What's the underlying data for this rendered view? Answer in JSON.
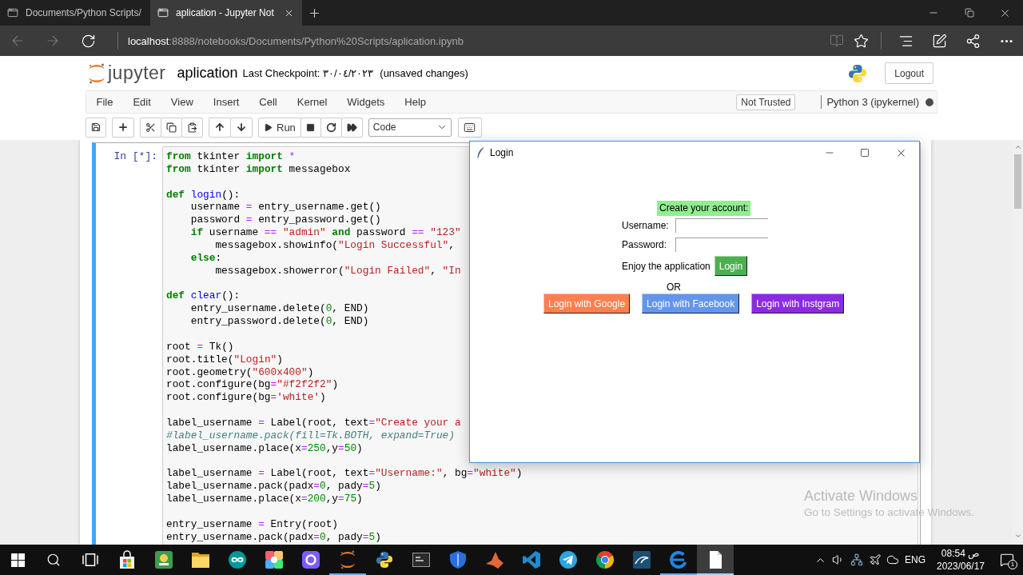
{
  "browser": {
    "tabs": [
      {
        "title": "Documents/Python Scripts/",
        "selected": false
      },
      {
        "title": "aplication - Jupyter Not",
        "selected": true
      }
    ],
    "navigation": {
      "back_disabled": true,
      "forward_disabled": true
    },
    "address": {
      "host": "localhost",
      "rest": ":8888/notebooks/Documents/Python%20Scripts/aplication.ipynb"
    }
  },
  "header": {
    "logo_text": "jupyter",
    "notebook_name": "aplication",
    "checkpoint": "Last Checkpoint: ٣٠/٠٤/٢٠٢٣",
    "save_status": "(unsaved changes)",
    "logout": "Logout"
  },
  "menu_bar": {
    "items": [
      "File",
      "Edit",
      "View",
      "Insert",
      "Cell",
      "Kernel",
      "Widgets",
      "Help"
    ],
    "trust": "Not Trusted",
    "kernel": "Python 3 (ipykernel)",
    "kernel_busy": true
  },
  "toolbar": {
    "run_label": "Run",
    "cell_type": "Code"
  },
  "cell": {
    "prompt": "In [*]:",
    "selected": true,
    "code_blocks": [
      {
        "lines": [
          {
            "tokens": [
              {
                "kind": "keyword",
                "text": "from"
              },
              {
                "kind": "plain",
                "text": " tkinter "
              },
              {
                "kind": "keyword",
                "text": "import"
              },
              {
                "kind": "operator",
                "text": " *"
              }
            ]
          },
          {
            "tokens": [
              {
                "kind": "keyword",
                "text": "from"
              },
              {
                "kind": "plain",
                "text": " tkinter "
              },
              {
                "kind": "keyword",
                "text": "import"
              },
              {
                "kind": "plain",
                "text": " messagebox"
              }
            ]
          }
        ]
      },
      {
        "lines": [
          {
            "tokens": [
              {
                "kind": "keyword",
                "text": "def"
              },
              {
                "kind": "name",
                "text": " login"
              },
              {
                "kind": "plain",
                "text": "():"
              }
            ],
            "children": [
              {
                "tokens": [
                  {
                    "kind": "plain",
                    "text": "username "
                  },
                  {
                    "kind": "operator",
                    "text": "="
                  },
                  {
                    "kind": "plain",
                    "text": " entry_username.get()"
                  }
                ]
              },
              {
                "tokens": [
                  {
                    "kind": "plain",
                    "text": "password "
                  },
                  {
                    "kind": "operator",
                    "text": "="
                  },
                  {
                    "kind": "plain",
                    "text": " entry_password.get()"
                  }
                ]
              },
              {
                "tokens": [
                  {
                    "kind": "keyword",
                    "text": "if"
                  },
                  {
                    "kind": "plain",
                    "text": " username "
                  },
                  {
                    "kind": "operator",
                    "text": "=="
                  },
                  {
                    "kind": "string",
                    "text": " \"admin\""
                  },
                  {
                    "kind": "keyword",
                    "text": " and"
                  },
                  {
                    "kind": "plain",
                    "text": " password "
                  },
                  {
                    "kind": "operator",
                    "text": "=="
                  },
                  {
                    "kind": "string",
                    "text": " \"123\""
                  }
                ],
                "children": [
                  {
                    "tokens": [
                      {
                        "kind": "plain",
                        "text": "messagebox.showinfo("
                      },
                      {
                        "kind": "string",
                        "text": "\"Login Successful\""
                      },
                      {
                        "kind": "plain",
                        "text": ","
                      }
                    ]
                  }
                ]
              },
              {
                "tokens": [
                  {
                    "kind": "keyword",
                    "text": "else"
                  },
                  {
                    "kind": "plain",
                    "text": ":"
                  }
                ],
                "children": [
                  {
                    "tokens": [
                      {
                        "kind": "plain",
                        "text": "messagebox.showerror("
                      },
                      {
                        "kind": "string",
                        "text": "\"Login Failed\""
                      },
                      {
                        "kind": "plain",
                        "text": ", "
                      },
                      {
                        "kind": "string",
                        "text": "\"In"
                      }
                    ]
                  }
                ]
              }
            ]
          }
        ]
      },
      {
        "lines": [
          {
            "tokens": [
              {
                "kind": "keyword",
                "text": "def"
              },
              {
                "kind": "name",
                "text": " clear"
              },
              {
                "kind": "plain",
                "text": "():"
              }
            ],
            "children": [
              {
                "tokens": [
                  {
                    "kind": "plain",
                    "text": "entry_username.delete("
                  },
                  {
                    "kind": "number",
                    "text": "0"
                  },
                  {
                    "kind": "plain",
                    "text": ", END)"
                  }
                ]
              },
              {
                "tokens": [
                  {
                    "kind": "plain",
                    "text": "entry_password.delete("
                  },
                  {
                    "kind": "number",
                    "text": "0"
                  },
                  {
                    "kind": "plain",
                    "text": ", END)"
                  }
                ]
              }
            ]
          }
        ]
      },
      {
        "lines": [
          {
            "tokens": [
              {
                "kind": "plain",
                "text": "root "
              },
              {
                "kind": "operator",
                "text": "="
              },
              {
                "kind": "plain",
                "text": " Tk()"
              }
            ]
          },
          {
            "tokens": [
              {
                "kind": "plain",
                "text": "root.title("
              },
              {
                "kind": "string",
                "text": "\"Login\""
              },
              {
                "kind": "plain",
                "text": ")"
              }
            ]
          },
          {
            "tokens": [
              {
                "kind": "plain",
                "text": "root.geometry("
              },
              {
                "kind": "string",
                "text": "\"600x400\""
              },
              {
                "kind": "plain",
                "text": ")"
              }
            ]
          },
          {
            "tokens": [
              {
                "kind": "plain",
                "text": "root.configure(bg"
              },
              {
                "kind": "operator",
                "text": "="
              },
              {
                "kind": "string",
                "text": "\"#f2f2f2\""
              },
              {
                "kind": "plain",
                "text": ")"
              }
            ]
          },
          {
            "tokens": [
              {
                "kind": "plain",
                "text": "root.configure(bg"
              },
              {
                "kind": "operator",
                "text": "="
              },
              {
                "kind": "string",
                "text": "'white'"
              },
              {
                "kind": "plain",
                "text": ")"
              }
            ]
          }
        ]
      },
      {
        "lines": [
          {
            "tokens": [
              {
                "kind": "plain",
                "text": "label_username "
              },
              {
                "kind": "operator",
                "text": "="
              },
              {
                "kind": "plain",
                "text": " Label(root, text"
              },
              {
                "kind": "operator",
                "text": "="
              },
              {
                "kind": "string",
                "text": "\"Create your a"
              }
            ]
          },
          {
            "tokens": [
              {
                "kind": "comment",
                "text": "#label_username.pack(fill=Tk.BOTH, expand=True)"
              }
            ]
          },
          {
            "tokens": [
              {
                "kind": "plain",
                "text": "label_username.place(x"
              },
              {
                "kind": "operator",
                "text": "="
              },
              {
                "kind": "number",
                "text": "250"
              },
              {
                "kind": "plain",
                "text": ",y"
              },
              {
                "kind": "operator",
                "text": "="
              },
              {
                "kind": "number",
                "text": "50"
              },
              {
                "kind": "plain",
                "text": ")"
              }
            ]
          }
        ]
      },
      {
        "lines": [
          {
            "tokens": [
              {
                "kind": "plain",
                "text": "label_username "
              },
              {
                "kind": "operator",
                "text": "="
              },
              {
                "kind": "plain",
                "text": " Label(root, text"
              },
              {
                "kind": "operator",
                "text": "="
              },
              {
                "kind": "string",
                "text": "\"Username:\""
              },
              {
                "kind": "plain",
                "text": ", bg"
              },
              {
                "kind": "operator",
                "text": "="
              },
              {
                "kind": "string",
                "text": "\"white\""
              },
              {
                "kind": "plain",
                "text": ")"
              }
            ]
          },
          {
            "tokens": [
              {
                "kind": "plain",
                "text": "label_username.pack(padx"
              },
              {
                "kind": "operator",
                "text": "="
              },
              {
                "kind": "number",
                "text": "0"
              },
              {
                "kind": "plain",
                "text": ", pady"
              },
              {
                "kind": "operator",
                "text": "="
              },
              {
                "kind": "number",
                "text": "5"
              },
              {
                "kind": "plain",
                "text": ")"
              }
            ]
          },
          {
            "tokens": [
              {
                "kind": "plain",
                "text": "label_username.place(x"
              },
              {
                "kind": "operator",
                "text": "="
              },
              {
                "kind": "number",
                "text": "200"
              },
              {
                "kind": "plain",
                "text": ",y"
              },
              {
                "kind": "operator",
                "text": "="
              },
              {
                "kind": "number",
                "text": "75"
              },
              {
                "kind": "plain",
                "text": ")"
              }
            ]
          }
        ]
      },
      {
        "lines": [
          {
            "tokens": [
              {
                "kind": "plain",
                "text": "entry_username "
              },
              {
                "kind": "operator",
                "text": "="
              },
              {
                "kind": "plain",
                "text": " Entry(root)"
              }
            ]
          },
          {
            "tokens": [
              {
                "kind": "plain",
                "text": "entry_username.pack(padx"
              },
              {
                "kind": "operator",
                "text": "="
              },
              {
                "kind": "number",
                "text": "0"
              },
              {
                "kind": "plain",
                "text": ", pady"
              },
              {
                "kind": "operator",
                "text": "="
              },
              {
                "kind": "number",
                "text": "5"
              },
              {
                "kind": "plain",
                "text": ")"
              }
            ]
          }
        ]
      }
    ]
  },
  "login_window": {
    "title": "Login",
    "heading": "Create your account:",
    "fields": [
      {
        "label": "Username:"
      },
      {
        "label": "Password:"
      }
    ],
    "note": "Enjoy the application",
    "login_button": "Login",
    "separator": "OR",
    "social_buttons": [
      {
        "label": "Login with Google",
        "color": "#ff7f50"
      },
      {
        "label": "Login with Facebook",
        "color": "#6495ed"
      },
      {
        "label": "Login with Instgram",
        "color": "#8a2be2"
      }
    ]
  },
  "activation_notice": {
    "title": "Activate Windows",
    "hint": "Go to Settings to activate Windows."
  },
  "taskbar": {
    "apps": [
      {
        "kind": "store",
        "running": false,
        "focused": false
      },
      {
        "kind": "tile",
        "running": false,
        "focused": false
      },
      {
        "kind": "folder",
        "running": false,
        "focused": false
      },
      {
        "kind": "infinity",
        "running": false,
        "focused": false
      },
      {
        "kind": "palette",
        "running": false,
        "focused": false
      },
      {
        "kind": "pad",
        "running": false,
        "focused": false
      },
      {
        "kind": "arcs",
        "running": true,
        "focused": false
      },
      {
        "kind": "snake",
        "running": false,
        "focused": false
      },
      {
        "kind": "terminal",
        "running": false,
        "focused": false
      },
      {
        "kind": "shield",
        "running": false,
        "focused": false
      },
      {
        "kind": "peak",
        "running": false,
        "focused": false
      },
      {
        "kind": "ribbon",
        "running": false,
        "focused": false
      },
      {
        "kind": "plane",
        "running": false,
        "focused": false
      },
      {
        "kind": "wheel",
        "running": false,
        "focused": false
      },
      {
        "kind": "dolphin",
        "running": false,
        "focused": false
      },
      {
        "kind": "swirl",
        "running": true,
        "focused": false
      },
      {
        "kind": "page",
        "running": true,
        "focused": true
      }
    ],
    "language": "ENG",
    "time": "08:54 ص",
    "date": "2023/06/17",
    "notifications": "1"
  }
}
